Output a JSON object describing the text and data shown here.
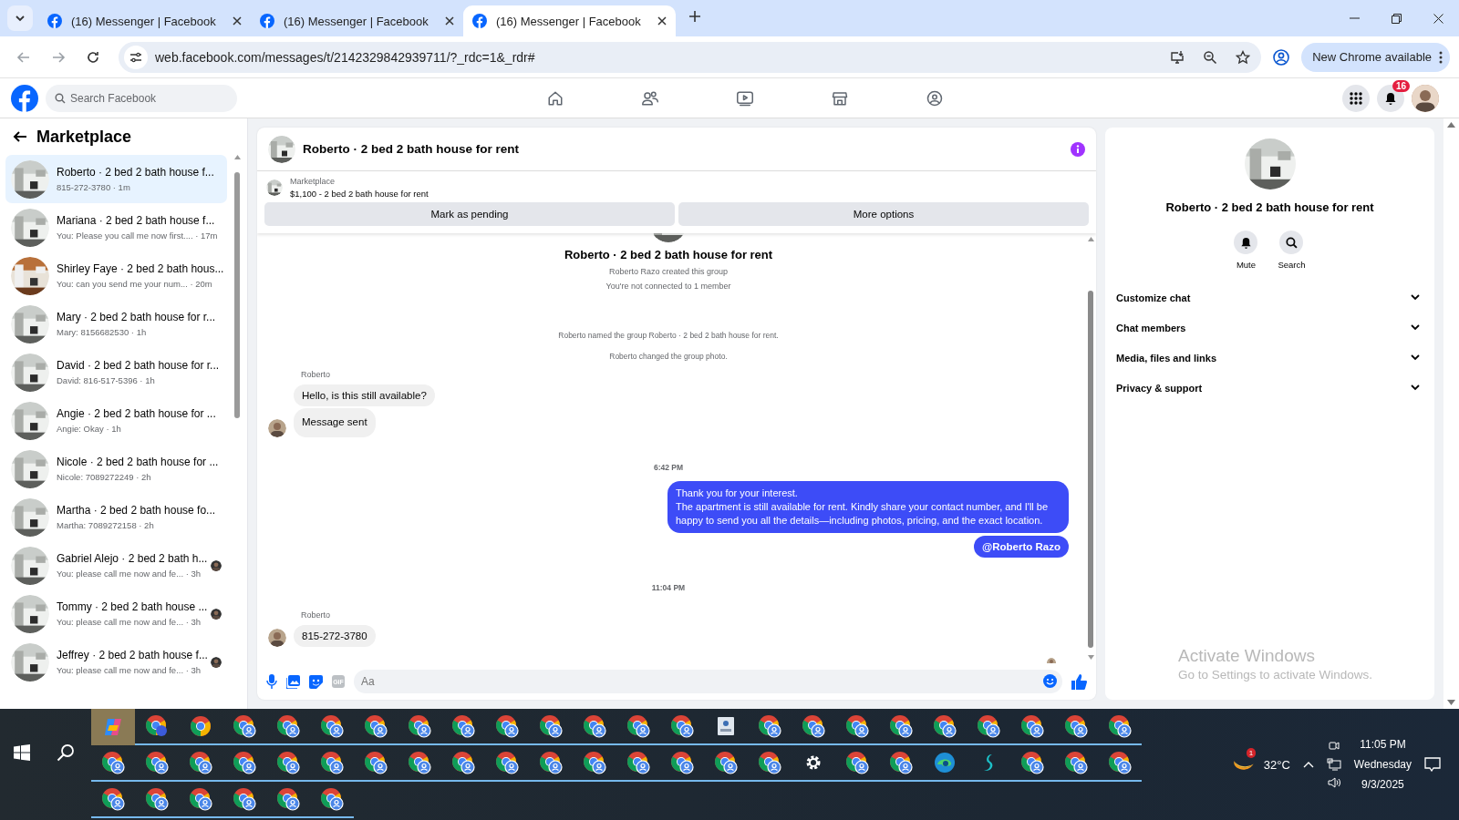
{
  "browser": {
    "tabs": [
      {
        "title": "(16) Messenger | Facebook",
        "selected": false
      },
      {
        "title": "(16) Messenger | Facebook",
        "selected": false
      },
      {
        "title": "(16) Messenger | Facebook",
        "selected": true
      }
    ],
    "url": "web.facebook.com/messages/t/2142329842939711/?_rdc=1&_rdr#",
    "update_button": "New Chrome available"
  },
  "facebook_header": {
    "search": {
      "placeholder": "Search Facebook"
    },
    "notification_count": "16"
  },
  "sidebar": {
    "title": "Marketplace",
    "conversations": [
      {
        "title": "Roberto · 2 bed 2 bath house f...",
        "preview": "815-272-3780 · 1m",
        "selected": true,
        "seen_avatar": false
      },
      {
        "title": "Mariana · 2 bed 2 bath house f...",
        "preview": "You: Please you call me now first.... · 17m",
        "selected": false,
        "seen_avatar": false
      },
      {
        "title": "Shirley Faye · 2 bed 2 bath hous...",
        "preview": "You: can you send me your num... · 20m",
        "selected": false,
        "seen_avatar": false
      },
      {
        "title": "Mary · 2 bed 2 bath house for r...",
        "preview": "Mary: 8156682530 · 1h",
        "selected": false,
        "seen_avatar": false
      },
      {
        "title": "David · 2 bed 2 bath house for r...",
        "preview": "David: 816-517-5396 · 1h",
        "selected": false,
        "seen_avatar": false
      },
      {
        "title": "Angie · 2 bed 2 bath house for ...",
        "preview": "Angie: Okay · 1h",
        "selected": false,
        "seen_avatar": false
      },
      {
        "title": "Nicole · 2 bed 2 bath house for ...",
        "preview": "Nicole: 7089272249 · 2h",
        "selected": false,
        "seen_avatar": false
      },
      {
        "title": "Martha · 2 bed 2 bath house fo...",
        "preview": "Martha: 7089272158 · 2h",
        "selected": false,
        "seen_avatar": false
      },
      {
        "title": "Gabriel Alejo · 2 bed 2 bath h...",
        "preview": "You: please call me now and fe... · 3h",
        "selected": false,
        "seen_avatar": true
      },
      {
        "title": "Tommy · 2 bed 2 bath house ...",
        "preview": "You: please call me now and fe... · 3h",
        "selected": false,
        "seen_avatar": true
      },
      {
        "title": "Jeffrey · 2 bed 2 bath house f...",
        "preview": "You: please call me now and fe... · 3h",
        "selected": false,
        "seen_avatar": true
      }
    ]
  },
  "chat": {
    "title": "Roberto · 2 bed 2 bath house for rent",
    "listing": {
      "label": "Marketplace",
      "price_title": "$1,100 - 2 bed 2 bath house for rent",
      "buttons": [
        "Mark as pending",
        "More options"
      ]
    },
    "intro": {
      "title": "Roberto · 2 bed 2 bath house for rent",
      "lines": [
        "Roberto Razo created this group",
        "You're not connected to 1 member"
      ]
    },
    "messages": [
      {
        "kind": "system",
        "text": "Roberto named the group Roberto · 2 bed 2 bath house for rent."
      },
      {
        "kind": "system",
        "text": "Roberto changed the group photo."
      },
      {
        "kind": "sender",
        "text": "Roberto"
      },
      {
        "kind": "incoming",
        "text": "Hello, is this still available?",
        "avatar": false
      },
      {
        "kind": "incoming",
        "text": "Message sent",
        "avatar": true
      },
      {
        "kind": "time",
        "text": "6:42 PM"
      },
      {
        "kind": "outgoing",
        "text": "Thank you for your interest.\nThe apartment is still available for rent. Kindly share your contact number, and I'll be happy to send you all the details—including photos, pricing, and the exact location."
      },
      {
        "kind": "mention",
        "text": "@Roberto Razo"
      },
      {
        "kind": "time",
        "text": "11:04 PM"
      },
      {
        "kind": "sender",
        "text": "Roberto"
      },
      {
        "kind": "incoming",
        "text": "815-272-3780",
        "avatar": true
      }
    ],
    "read_receipt": true,
    "composer": {
      "placeholder": "Aa",
      "gif_label": "GIF"
    }
  },
  "details": {
    "title": "Roberto · 2 bed 2 bath house for rent",
    "actions": [
      "Mute",
      "Search"
    ],
    "sections": [
      {
        "label": "Customize chat",
        "expanded": false
      },
      {
        "label": "Chat members",
        "expanded": false
      },
      {
        "label": "Media, files and links",
        "expanded": false
      },
      {
        "label": "Privacy & support",
        "expanded": false
      }
    ],
    "activation_notice": {
      "title": "Activate Windows",
      "text": "Go to Settings to activate Windows."
    }
  },
  "taskbar": {
    "rows": [
      [
        {
          "kind": "copilot"
        },
        {
          "kind": "chromeletter"
        },
        {
          "kind": "chrome"
        },
        {
          "kind": "chromeprofile"
        },
        {
          "kind": "chromeprofile"
        },
        {
          "kind": "chromeprofile"
        },
        {
          "kind": "chromeprofile"
        },
        {
          "kind": "chromeprofile"
        },
        {
          "kind": "chromeprofile"
        },
        {
          "kind": "chromeprofile"
        },
        {
          "kind": "chromeprofile"
        },
        {
          "kind": "chromeprofile"
        },
        {
          "kind": "chromeprofile"
        },
        {
          "kind": "chromeprofile"
        },
        {
          "kind": "idcard"
        },
        {
          "kind": "chromeprofile"
        },
        {
          "kind": "chromeprofile"
        },
        {
          "kind": "chromeprofile"
        },
        {
          "kind": "chromeprofile"
        },
        {
          "kind": "chromeprofile"
        },
        {
          "kind": "chromeprofile"
        },
        {
          "kind": "chromeprofile"
        },
        {
          "kind": "chromeprofile"
        },
        {
          "kind": "chromeprofile"
        }
      ],
      [
        {
          "kind": "chromeprofile"
        },
        {
          "kind": "chromeprofile"
        },
        {
          "kind": "chromeprofile"
        },
        {
          "kind": "chromeprofile"
        },
        {
          "kind": "chromeprofile"
        },
        {
          "kind": "chromeprofile"
        },
        {
          "kind": "chromeprofile"
        },
        {
          "kind": "chromeprofile"
        },
        {
          "kind": "chromeprofile"
        },
        {
          "kind": "chromeprofile"
        },
        {
          "kind": "chromeprofile"
        },
        {
          "kind": "chromeprofile"
        },
        {
          "kind": "chromeprofile"
        },
        {
          "kind": "chromeprofile"
        },
        {
          "kind": "chromeprofile"
        },
        {
          "kind": "chromeprofile"
        },
        {
          "kind": "gear"
        },
        {
          "kind": "chromeprofile"
        },
        {
          "kind": "chromeprofile"
        },
        {
          "kind": "edge"
        },
        {
          "kind": "swoosh"
        },
        {
          "kind": "chromeprofile"
        },
        {
          "kind": "chromeprofile"
        },
        {
          "kind": "chromeprofile"
        }
      ],
      [
        {
          "kind": "chromeprofile"
        },
        {
          "kind": "chromeprofile"
        },
        {
          "kind": "chromeprofile"
        },
        {
          "kind": "chromeprofile"
        },
        {
          "kind": "chromeprofile"
        },
        {
          "kind": "chromeprofile"
        }
      ]
    ],
    "weather": {
      "badge": "1",
      "temperature": "32°C"
    },
    "clock": {
      "time": "11:05 PM",
      "day": "Wednesday",
      "date": "9/3/2025"
    }
  }
}
